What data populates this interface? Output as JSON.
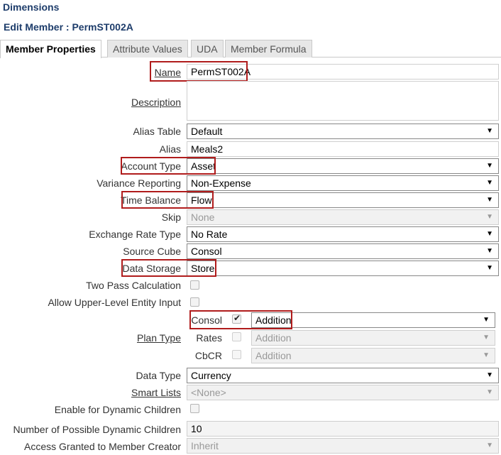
{
  "header": {
    "title": "Dimensions",
    "subtitle": "Edit Member : PermST002A"
  },
  "tabs": [
    "Member Properties",
    "Attribute Values",
    "UDA",
    "Member Formula"
  ],
  "form": {
    "name": {
      "label": "Name",
      "value": "PermST002A"
    },
    "description": {
      "label": "Description",
      "value": ""
    },
    "alias_table": {
      "label": "Alias Table",
      "value": "Default"
    },
    "alias": {
      "label": "Alias",
      "value": "Meals2"
    },
    "account_type": {
      "label": "Account Type",
      "value": "Asset"
    },
    "variance_reporting": {
      "label": "Variance Reporting",
      "value": "Non-Expense"
    },
    "time_balance": {
      "label": "Time Balance",
      "value": "Flow"
    },
    "skip": {
      "label": "Skip",
      "value": "None"
    },
    "exchange_rate_type": {
      "label": "Exchange Rate Type",
      "value": "No Rate"
    },
    "source_cube": {
      "label": "Source Cube",
      "value": "Consol"
    },
    "data_storage": {
      "label": "Data Storage",
      "value": "Store"
    },
    "two_pass": {
      "label": "Two Pass Calculation",
      "checked": false
    },
    "upper_level_entity": {
      "label": "Allow Upper-Level Entity Input",
      "checked": false
    },
    "plan_type": {
      "label": "Plan Type",
      "rows": [
        {
          "name": "Consol",
          "checked": true,
          "value": "Addition"
        },
        {
          "name": "Rates",
          "checked": false,
          "value": "Addition"
        },
        {
          "name": "CbCR",
          "checked": false,
          "value": "Addition"
        }
      ]
    },
    "data_type": {
      "label": "Data Type",
      "value": "Currency"
    },
    "smart_lists": {
      "label": "Smart Lists",
      "value": "<None>"
    },
    "dynamic_children": {
      "label": "Enable for Dynamic Children",
      "checked": false
    },
    "num_dynamic_children": {
      "label": "Number of Possible Dynamic Children",
      "value": "10"
    },
    "access_granted": {
      "label": "Access Granted to Member Creator",
      "value": "Inherit"
    }
  },
  "colors": {
    "header": "#1e3d6b",
    "highlight": "#b01c1c"
  }
}
